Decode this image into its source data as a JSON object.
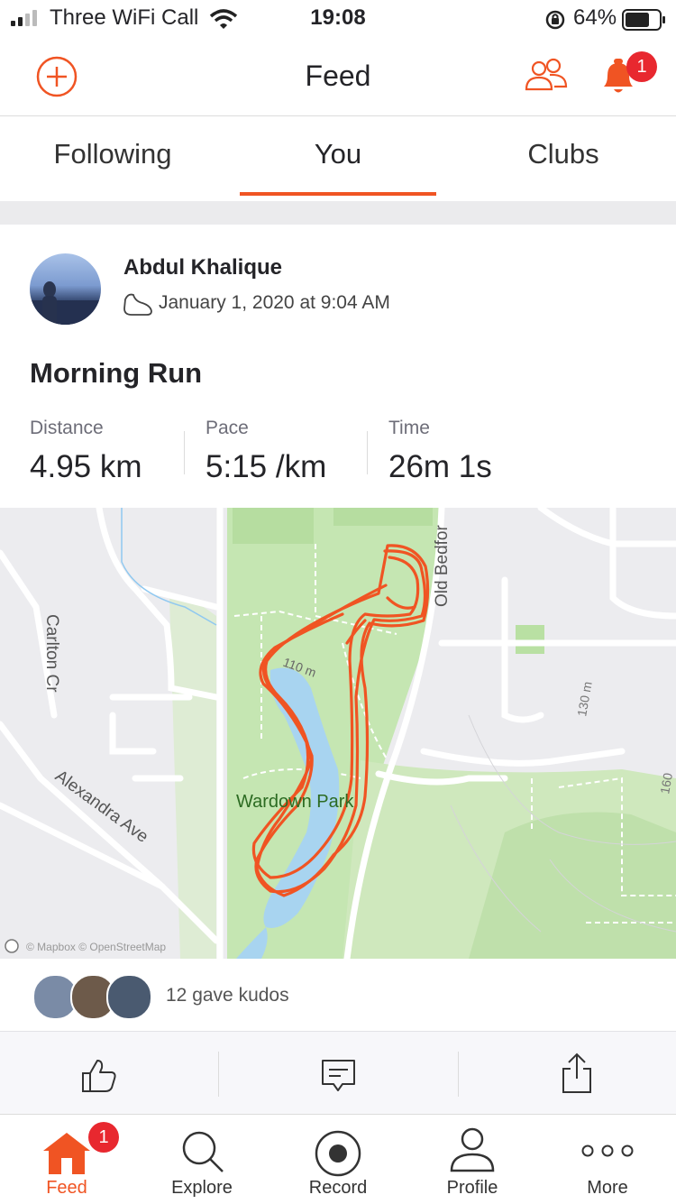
{
  "status_bar": {
    "carrier": "Three WiFi Call",
    "time": "19:08",
    "battery": "64%"
  },
  "header": {
    "title": "Feed",
    "notification_count": "1"
  },
  "tabs": [
    {
      "label": "Following"
    },
    {
      "label": "You"
    },
    {
      "label": "Clubs"
    }
  ],
  "activity": {
    "athlete": "Abdul Khalique",
    "date": "January 1, 2020 at 9:04 AM",
    "title": "Morning Run",
    "stats": [
      {
        "label": "Distance",
        "value": "4.95 km"
      },
      {
        "label": "Pace",
        "value": "5:15 /km"
      },
      {
        "label": "Time",
        "value": "26m 1s"
      }
    ],
    "map": {
      "park": "Wardown Park",
      "streets": [
        "Carlton Cr",
        "Alexandra Ave",
        "Old Bedfor"
      ],
      "contours": [
        "110 m",
        "130 m",
        "160"
      ],
      "attribution": "© Mapbox © OpenStreetMap",
      "route_color": "#f05423"
    },
    "kudos": "12 gave kudos"
  },
  "tab_bar": {
    "items": [
      {
        "label": "Feed"
      },
      {
        "label": "Explore"
      },
      {
        "label": "Record"
      },
      {
        "label": "Profile"
      },
      {
        "label": "More"
      }
    ],
    "feed_badge": "1"
  },
  "colors": {
    "accent": "#f05423",
    "badge": "#e8282f"
  }
}
